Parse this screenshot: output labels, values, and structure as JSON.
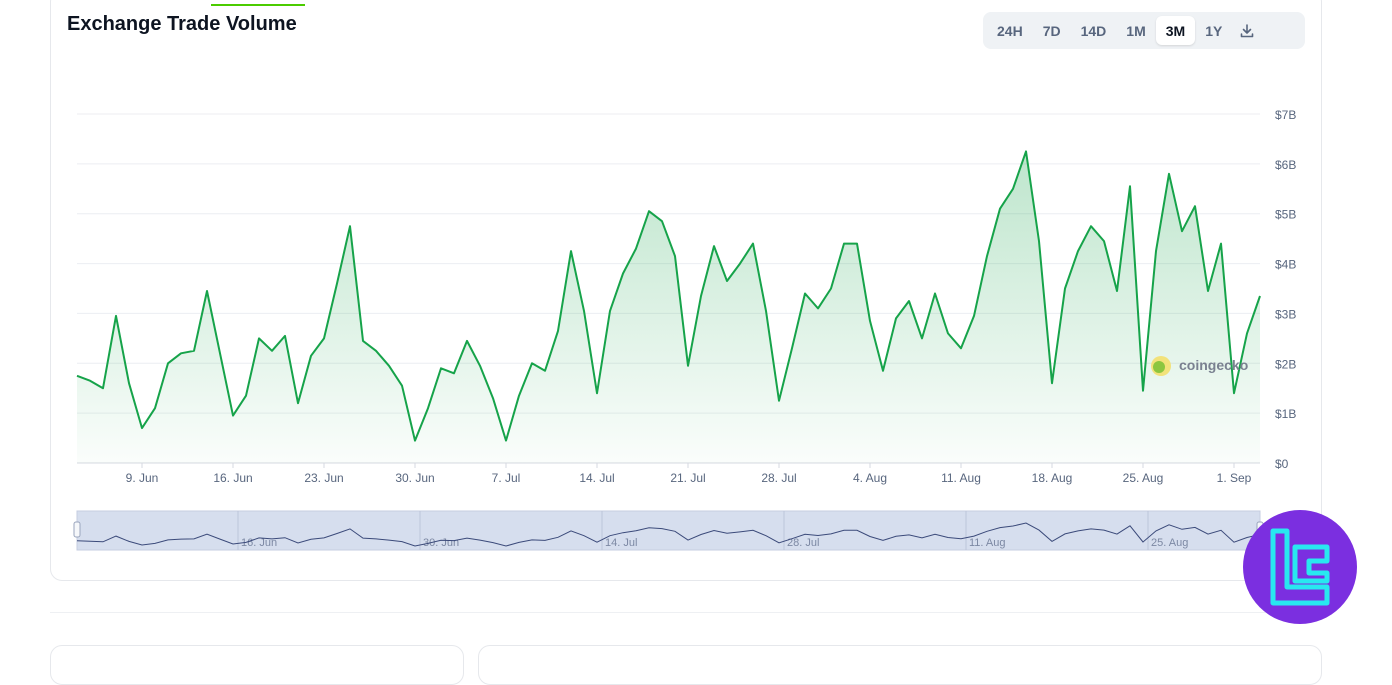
{
  "header": {
    "title": "Exchange Trade Volume"
  },
  "range_buttons": [
    "24H",
    "7D",
    "14D",
    "1M",
    "3M",
    "1Y"
  ],
  "active_range": "3M",
  "watermark": "coingecko",
  "colors": {
    "line": "#16a34a",
    "fill": "#16a34a",
    "navigator_fill": "#d6deee",
    "navigator_line": "#3b4a7a",
    "logo_bg": "#7b2fe0",
    "logo_fg": "#28e8f0"
  },
  "chart_data": {
    "type": "area",
    "title": "Exchange Trade Volume",
    "ylim": [
      0,
      7000000000
    ],
    "yticks": [
      0,
      1000000000,
      2000000000,
      3000000000,
      4000000000,
      5000000000,
      6000000000,
      7000000000
    ],
    "ytick_labels": [
      "$0",
      "$1B",
      "$2B",
      "$3B",
      "$4B",
      "$5B",
      "$6B",
      "$7B"
    ],
    "xtick_labels": [
      "9. Jun",
      "16. Jun",
      "23. Jun",
      "30. Jun",
      "7. Jul",
      "14. Jul",
      "21. Jul",
      "28. Jul",
      "4. Aug",
      "11. Aug",
      "18. Aug",
      "25. Aug",
      "1. Sep"
    ],
    "navigator_labels": [
      "16. Jun",
      "30. Jun",
      "14. Jul",
      "28. Jul",
      "11. Aug",
      "25. Aug"
    ],
    "series": [
      {
        "values": [
          1.75,
          1.65,
          1.5,
          2.95,
          1.6,
          0.7,
          1.1,
          2.0,
          2.2,
          2.25,
          3.45,
          2.2,
          0.95,
          1.35,
          2.5,
          2.25,
          2.55,
          1.2,
          2.15,
          2.5,
          3.6,
          4.75,
          2.45,
          2.25,
          1.95,
          1.55,
          0.45,
          1.1,
          1.9,
          1.8,
          2.45,
          1.95,
          1.3,
          0.45,
          1.35,
          2.0,
          1.85,
          2.65,
          4.25,
          3.05,
          1.4,
          3.05,
          3.8,
          4.3,
          5.05,
          4.85,
          4.15,
          1.95,
          3.35,
          4.35,
          3.65,
          4.0,
          4.4,
          3.05,
          1.25,
          2.3,
          3.4,
          3.1,
          3.5,
          4.4,
          4.4,
          2.85,
          1.85,
          2.9,
          3.25,
          2.5,
          3.4,
          2.6,
          2.3,
          2.95,
          4.15,
          5.1,
          5.5,
          6.25,
          4.45,
          1.6,
          3.5,
          4.25,
          4.75,
          4.45,
          3.45,
          5.55,
          1.45,
          4.25,
          5.8,
          4.65,
          5.15,
          3.45,
          4.4,
          1.4,
          2.6,
          3.35
        ]
      }
    ]
  }
}
